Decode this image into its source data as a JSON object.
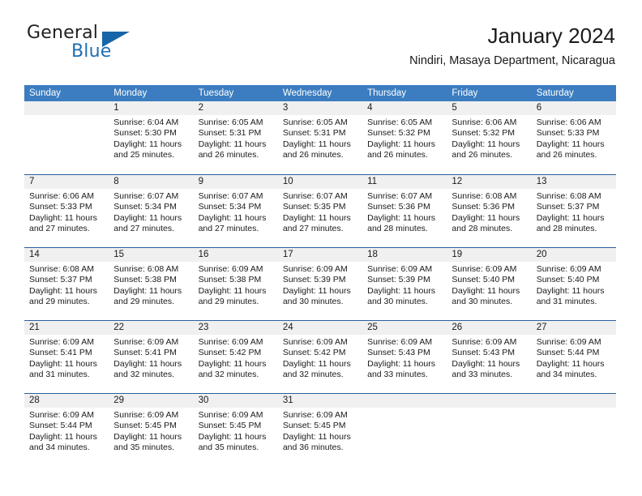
{
  "brand": {
    "name_part1": "General",
    "name_part2": "Blue",
    "flag_icon": "flag-triangle-icon"
  },
  "header": {
    "title": "January 2024",
    "subtitle": "Nindiri, Masaya Department, Nicaragua"
  },
  "calendar": {
    "weekdays": [
      "Sunday",
      "Monday",
      "Tuesday",
      "Wednesday",
      "Thursday",
      "Friday",
      "Saturday"
    ],
    "colors": {
      "header_blue": "#3b7dc0",
      "separator_blue": "#2a5f9e",
      "band_gray": "#f0f0f0",
      "brand_blue": "#1f6fb2",
      "text": "#1a1a1a"
    },
    "weeks": [
      [
        {
          "day": "",
          "sunrise": "",
          "sunset": "",
          "daylight_line1": "",
          "daylight_line2": ""
        },
        {
          "day": "1",
          "sunrise": "Sunrise: 6:04 AM",
          "sunset": "Sunset: 5:30 PM",
          "daylight_line1": "Daylight: 11 hours",
          "daylight_line2": "and 25 minutes."
        },
        {
          "day": "2",
          "sunrise": "Sunrise: 6:05 AM",
          "sunset": "Sunset: 5:31 PM",
          "daylight_line1": "Daylight: 11 hours",
          "daylight_line2": "and 26 minutes."
        },
        {
          "day": "3",
          "sunrise": "Sunrise: 6:05 AM",
          "sunset": "Sunset: 5:31 PM",
          "daylight_line1": "Daylight: 11 hours",
          "daylight_line2": "and 26 minutes."
        },
        {
          "day": "4",
          "sunrise": "Sunrise: 6:05 AM",
          "sunset": "Sunset: 5:32 PM",
          "daylight_line1": "Daylight: 11 hours",
          "daylight_line2": "and 26 minutes."
        },
        {
          "day": "5",
          "sunrise": "Sunrise: 6:06 AM",
          "sunset": "Sunset: 5:32 PM",
          "daylight_line1": "Daylight: 11 hours",
          "daylight_line2": "and 26 minutes."
        },
        {
          "day": "6",
          "sunrise": "Sunrise: 6:06 AM",
          "sunset": "Sunset: 5:33 PM",
          "daylight_line1": "Daylight: 11 hours",
          "daylight_line2": "and 26 minutes."
        }
      ],
      [
        {
          "day": "7",
          "sunrise": "Sunrise: 6:06 AM",
          "sunset": "Sunset: 5:33 PM",
          "daylight_line1": "Daylight: 11 hours",
          "daylight_line2": "and 27 minutes."
        },
        {
          "day": "8",
          "sunrise": "Sunrise: 6:07 AM",
          "sunset": "Sunset: 5:34 PM",
          "daylight_line1": "Daylight: 11 hours",
          "daylight_line2": "and 27 minutes."
        },
        {
          "day": "9",
          "sunrise": "Sunrise: 6:07 AM",
          "sunset": "Sunset: 5:34 PM",
          "daylight_line1": "Daylight: 11 hours",
          "daylight_line2": "and 27 minutes."
        },
        {
          "day": "10",
          "sunrise": "Sunrise: 6:07 AM",
          "sunset": "Sunset: 5:35 PM",
          "daylight_line1": "Daylight: 11 hours",
          "daylight_line2": "and 27 minutes."
        },
        {
          "day": "11",
          "sunrise": "Sunrise: 6:07 AM",
          "sunset": "Sunset: 5:36 PM",
          "daylight_line1": "Daylight: 11 hours",
          "daylight_line2": "and 28 minutes."
        },
        {
          "day": "12",
          "sunrise": "Sunrise: 6:08 AM",
          "sunset": "Sunset: 5:36 PM",
          "daylight_line1": "Daylight: 11 hours",
          "daylight_line2": "and 28 minutes."
        },
        {
          "day": "13",
          "sunrise": "Sunrise: 6:08 AM",
          "sunset": "Sunset: 5:37 PM",
          "daylight_line1": "Daylight: 11 hours",
          "daylight_line2": "and 28 minutes."
        }
      ],
      [
        {
          "day": "14",
          "sunrise": "Sunrise: 6:08 AM",
          "sunset": "Sunset: 5:37 PM",
          "daylight_line1": "Daylight: 11 hours",
          "daylight_line2": "and 29 minutes."
        },
        {
          "day": "15",
          "sunrise": "Sunrise: 6:08 AM",
          "sunset": "Sunset: 5:38 PM",
          "daylight_line1": "Daylight: 11 hours",
          "daylight_line2": "and 29 minutes."
        },
        {
          "day": "16",
          "sunrise": "Sunrise: 6:09 AM",
          "sunset": "Sunset: 5:38 PM",
          "daylight_line1": "Daylight: 11 hours",
          "daylight_line2": "and 29 minutes."
        },
        {
          "day": "17",
          "sunrise": "Sunrise: 6:09 AM",
          "sunset": "Sunset: 5:39 PM",
          "daylight_line1": "Daylight: 11 hours",
          "daylight_line2": "and 30 minutes."
        },
        {
          "day": "18",
          "sunrise": "Sunrise: 6:09 AM",
          "sunset": "Sunset: 5:39 PM",
          "daylight_line1": "Daylight: 11 hours",
          "daylight_line2": "and 30 minutes."
        },
        {
          "day": "19",
          "sunrise": "Sunrise: 6:09 AM",
          "sunset": "Sunset: 5:40 PM",
          "daylight_line1": "Daylight: 11 hours",
          "daylight_line2": "and 30 minutes."
        },
        {
          "day": "20",
          "sunrise": "Sunrise: 6:09 AM",
          "sunset": "Sunset: 5:40 PM",
          "daylight_line1": "Daylight: 11 hours",
          "daylight_line2": "and 31 minutes."
        }
      ],
      [
        {
          "day": "21",
          "sunrise": "Sunrise: 6:09 AM",
          "sunset": "Sunset: 5:41 PM",
          "daylight_line1": "Daylight: 11 hours",
          "daylight_line2": "and 31 minutes."
        },
        {
          "day": "22",
          "sunrise": "Sunrise: 6:09 AM",
          "sunset": "Sunset: 5:41 PM",
          "daylight_line1": "Daylight: 11 hours",
          "daylight_line2": "and 32 minutes."
        },
        {
          "day": "23",
          "sunrise": "Sunrise: 6:09 AM",
          "sunset": "Sunset: 5:42 PM",
          "daylight_line1": "Daylight: 11 hours",
          "daylight_line2": "and 32 minutes."
        },
        {
          "day": "24",
          "sunrise": "Sunrise: 6:09 AM",
          "sunset": "Sunset: 5:42 PM",
          "daylight_line1": "Daylight: 11 hours",
          "daylight_line2": "and 32 minutes."
        },
        {
          "day": "25",
          "sunrise": "Sunrise: 6:09 AM",
          "sunset": "Sunset: 5:43 PM",
          "daylight_line1": "Daylight: 11 hours",
          "daylight_line2": "and 33 minutes."
        },
        {
          "day": "26",
          "sunrise": "Sunrise: 6:09 AM",
          "sunset": "Sunset: 5:43 PM",
          "daylight_line1": "Daylight: 11 hours",
          "daylight_line2": "and 33 minutes."
        },
        {
          "day": "27",
          "sunrise": "Sunrise: 6:09 AM",
          "sunset": "Sunset: 5:44 PM",
          "daylight_line1": "Daylight: 11 hours",
          "daylight_line2": "and 34 minutes."
        }
      ],
      [
        {
          "day": "28",
          "sunrise": "Sunrise: 6:09 AM",
          "sunset": "Sunset: 5:44 PM",
          "daylight_line1": "Daylight: 11 hours",
          "daylight_line2": "and 34 minutes."
        },
        {
          "day": "29",
          "sunrise": "Sunrise: 6:09 AM",
          "sunset": "Sunset: 5:45 PM",
          "daylight_line1": "Daylight: 11 hours",
          "daylight_line2": "and 35 minutes."
        },
        {
          "day": "30",
          "sunrise": "Sunrise: 6:09 AM",
          "sunset": "Sunset: 5:45 PM",
          "daylight_line1": "Daylight: 11 hours",
          "daylight_line2": "and 35 minutes."
        },
        {
          "day": "31",
          "sunrise": "Sunrise: 6:09 AM",
          "sunset": "Sunset: 5:45 PM",
          "daylight_line1": "Daylight: 11 hours",
          "daylight_line2": "and 36 minutes."
        },
        {
          "day": "",
          "sunrise": "",
          "sunset": "",
          "daylight_line1": "",
          "daylight_line2": ""
        },
        {
          "day": "",
          "sunrise": "",
          "sunset": "",
          "daylight_line1": "",
          "daylight_line2": ""
        },
        {
          "day": "",
          "sunrise": "",
          "sunset": "",
          "daylight_line1": "",
          "daylight_line2": ""
        }
      ]
    ]
  }
}
